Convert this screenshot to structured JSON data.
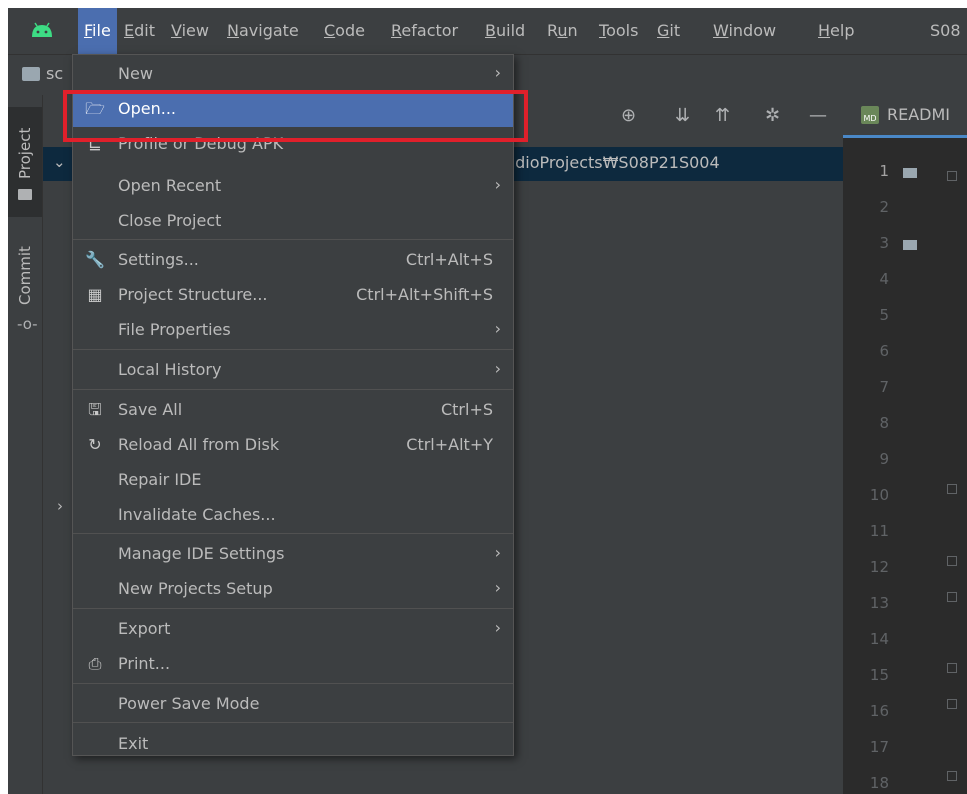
{
  "menubar": {
    "items": [
      {
        "label": "File",
        "u": "F",
        "rest": "ile"
      },
      {
        "label": "Edit",
        "u": "E",
        "rest": "dit"
      },
      {
        "label": "View",
        "u": "V",
        "rest": "iew"
      },
      {
        "label": "Navigate",
        "u": "N",
        "rest": "avigate"
      },
      {
        "label": "Code",
        "u": "C",
        "rest": "ode"
      },
      {
        "label": "Refactor",
        "u": "R",
        "rest": "efactor"
      },
      {
        "label": "Build",
        "u": "B",
        "rest": "uild"
      },
      {
        "label": "Run",
        "pre": "R",
        "u": "u",
        "rest": "n"
      },
      {
        "label": "Tools",
        "u": "T",
        "rest": "ools"
      },
      {
        "label": "Git",
        "u": "G",
        "rest": "it"
      },
      {
        "label": "Window",
        "u": "W",
        "rest": "indow"
      },
      {
        "label": "Help",
        "u": "H",
        "rest": "elp"
      }
    ],
    "project_title": "S08"
  },
  "navbar": {
    "project": "sc"
  },
  "toolstrip": {
    "project_label": "Project",
    "commit_label": "Commit"
  },
  "project_panel": {
    "selected_path": "udioProjects₩S08P21S004"
  },
  "editor": {
    "tab_name": "READMI",
    "line_numbers": [
      "1",
      "2",
      "3",
      "4",
      "5",
      "6",
      "7",
      "8",
      "9",
      "10",
      "11",
      "12",
      "13",
      "14",
      "15",
      "16",
      "17",
      "18"
    ]
  },
  "file_menu": {
    "items": [
      {
        "label": "New",
        "shortcut": "",
        "submenu": true,
        "icon": ""
      },
      {
        "label": "Open...",
        "shortcut": "",
        "submenu": false,
        "icon": "folder-open-icon",
        "highlighted": true
      },
      {
        "label": "Profile or Debug APK",
        "shortcut": "",
        "submenu": false,
        "icon": "apk-profile-icon"
      },
      {
        "label": "Open Recent",
        "shortcut": "",
        "submenu": true,
        "icon": ""
      },
      {
        "label": "Close Project",
        "shortcut": "",
        "submenu": false,
        "icon": ""
      },
      {
        "label": "Settings...",
        "shortcut": "Ctrl+Alt+S",
        "submenu": false,
        "icon": "wrench-icon"
      },
      {
        "label": "Project Structure...",
        "shortcut": "Ctrl+Alt+Shift+S",
        "submenu": false,
        "icon": "project-structure-icon"
      },
      {
        "label": "File Properties",
        "shortcut": "",
        "submenu": true,
        "icon": ""
      },
      {
        "label": "Local History",
        "shortcut": "",
        "submenu": true,
        "icon": ""
      },
      {
        "label": "Save All",
        "shortcut": "Ctrl+S",
        "submenu": false,
        "icon": "save-icon"
      },
      {
        "label": "Reload All from Disk",
        "shortcut": "Ctrl+Alt+Y",
        "submenu": false,
        "icon": "reload-icon"
      },
      {
        "label": "Repair IDE",
        "shortcut": "",
        "submenu": false,
        "icon": ""
      },
      {
        "label": "Invalidate Caches...",
        "shortcut": "",
        "submenu": false,
        "icon": ""
      },
      {
        "label": "Manage IDE Settings",
        "shortcut": "",
        "submenu": true,
        "icon": ""
      },
      {
        "label": "New Projects Setup",
        "shortcut": "",
        "submenu": true,
        "icon": ""
      },
      {
        "label": "Export",
        "shortcut": "",
        "submenu": true,
        "icon": ""
      },
      {
        "label": "Print...",
        "shortcut": "",
        "submenu": false,
        "icon": "print-icon"
      },
      {
        "label": "Power Save Mode",
        "shortcut": "",
        "submenu": false,
        "icon": ""
      },
      {
        "label": "Exit",
        "shortcut": "",
        "submenu": false,
        "icon": ""
      }
    ]
  },
  "colors": {
    "menu_bg": "#3c3f41",
    "editor_bg": "#2b2b2b",
    "highlight": "#4b6eaf",
    "annotation_box": "#e0202b"
  }
}
